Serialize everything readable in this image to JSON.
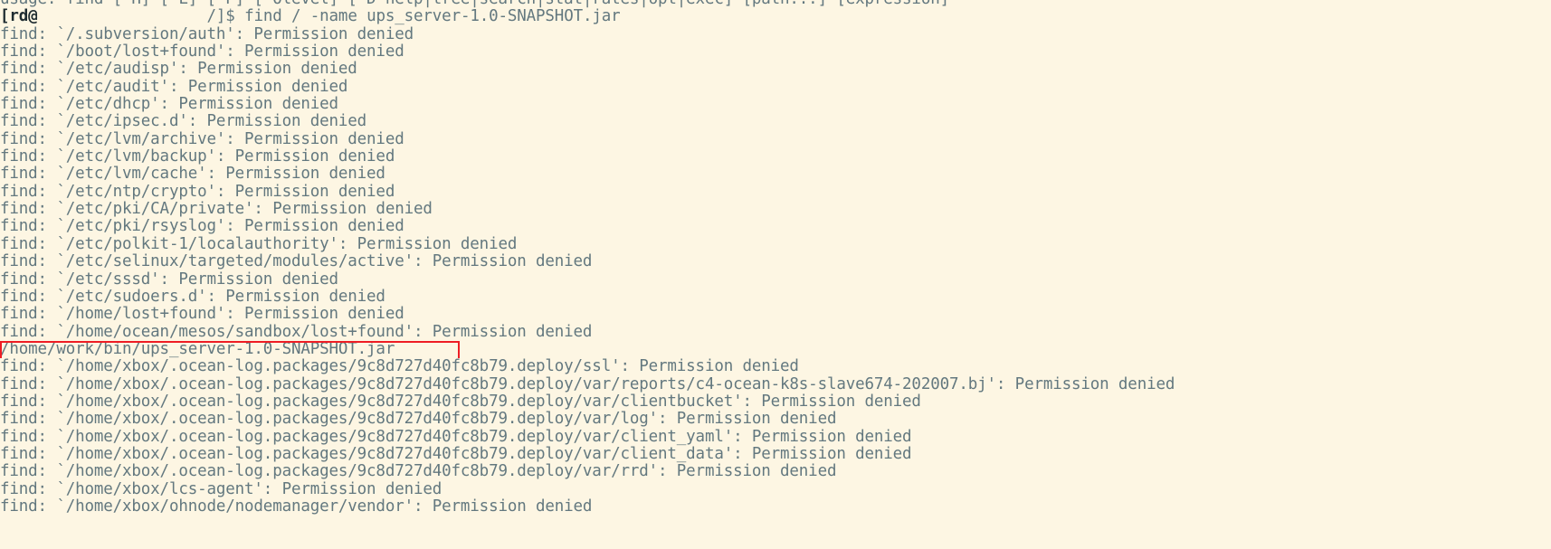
{
  "terminal": {
    "app": "terminal",
    "background_color": "#fdf6e3",
    "foreground_color": "#63787f",
    "prompt_color": "#1d2b30",
    "highlight_color": "#ee1d24",
    "usage_line": "usage: find [-H] [-L] [-P] [-Olevel] [-D help|tree|search|stat|rates|opt|exec] [path...] [expression]",
    "prompt": {
      "open_bracket": "[",
      "user": "rd@",
      "host": "",
      "path": "/",
      "close_bracket": "]",
      "sigil": "$",
      "command": " find / -name ups_server-1.0-SNAPSHOT.jar"
    },
    "highlighted_result": "/home/work/bin/ups_server-1.0-SNAPSHOT.jar",
    "lines": [
      "find: `/.subversion/auth': Permission denied",
      "find: `/boot/lost+found': Permission denied",
      "find: `/etc/audisp': Permission denied",
      "find: `/etc/audit': Permission denied",
      "find: `/etc/dhcp': Permission denied",
      "find: `/etc/ipsec.d': Permission denied",
      "find: `/etc/lvm/archive': Permission denied",
      "find: `/etc/lvm/backup': Permission denied",
      "find: `/etc/lvm/cache': Permission denied",
      "find: `/etc/ntp/crypto': Permission denied",
      "find: `/etc/pki/CA/private': Permission denied",
      "find: `/etc/pki/rsyslog': Permission denied",
      "find: `/etc/polkit-1/localauthority': Permission denied",
      "find: `/etc/selinux/targeted/modules/active': Permission denied",
      "find: `/etc/sssd': Permission denied",
      "find: `/etc/sudoers.d': Permission denied",
      "find: `/home/lost+found': Permission denied",
      "find: `/home/ocean/mesos/sandbox/lost+found': Permission denied"
    ],
    "lines_after": [
      "find: `/home/xbox/.ocean-log.packages/9c8d727d40fc8b79.deploy/ssl': Permission denied",
      "find: `/home/xbox/.ocean-log.packages/9c8d727d40fc8b79.deploy/var/reports/c4-ocean-k8s-slave674-202007.bj': Permission denied",
      "find: `/home/xbox/.ocean-log.packages/9c8d727d40fc8b79.deploy/var/clientbucket': Permission denied",
      "find: `/home/xbox/.ocean-log.packages/9c8d727d40fc8b79.deploy/var/log': Permission denied",
      "find: `/home/xbox/.ocean-log.packages/9c8d727d40fc8b79.deploy/var/client_yaml': Permission denied",
      "find: `/home/xbox/.ocean-log.packages/9c8d727d40fc8b79.deploy/var/client_data': Permission denied",
      "find: `/home/xbox/.ocean-log.packages/9c8d727d40fc8b79.deploy/var/rrd': Permission denied",
      "find: `/home/xbox/lcs-agent': Permission denied",
      "find: `/home/xbox/ohnode/nodemanager/vendor': Permission denied"
    ]
  }
}
